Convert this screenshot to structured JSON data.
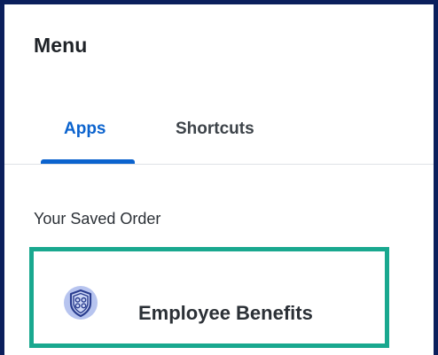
{
  "menu": {
    "title": "Menu"
  },
  "tabs": [
    {
      "label": "Apps",
      "active": true
    },
    {
      "label": "Shortcuts",
      "active": false
    }
  ],
  "saved_order": {
    "label": "Your Saved Order",
    "items": [
      {
        "label": "Employee Benefits",
        "icon": "shield-benefits-icon"
      }
    ]
  },
  "colors": {
    "frame_border": "#0b1f5c",
    "active_tab": "#0b63ce",
    "highlight_border": "#19a88f",
    "icon_fill": "#b7c4ef",
    "icon_stroke": "#2a3d8f"
  }
}
